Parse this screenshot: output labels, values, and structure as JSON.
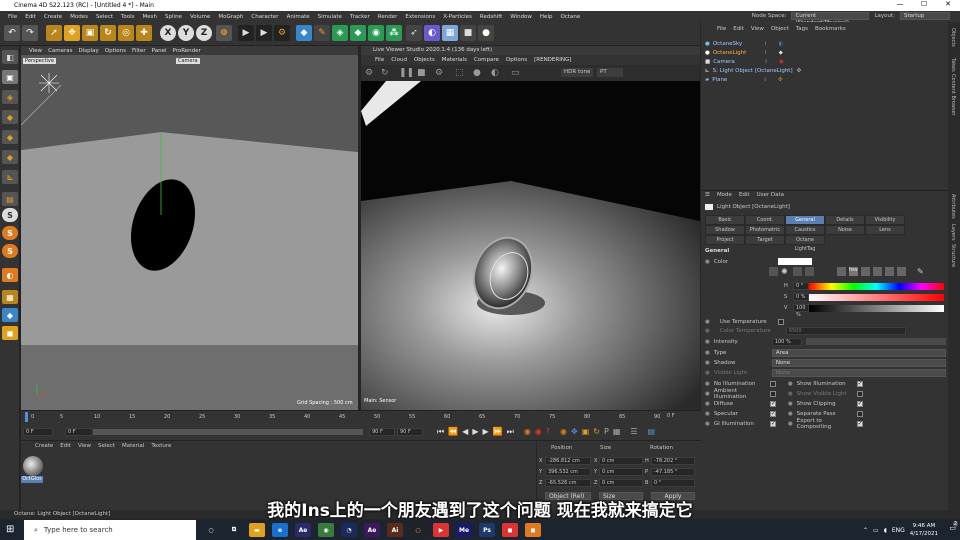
{
  "window": {
    "title": "Cinema 4D S22.123 (RC) - [Untitled 4 *] - Main",
    "min": "—",
    "max": "☐",
    "close": "✕"
  },
  "menu": [
    "File",
    "Edit",
    "Create",
    "Modes",
    "Select",
    "Tools",
    "Mesh",
    "Spline",
    "Volume",
    "MoGraph",
    "Character",
    "Animate",
    "Simulate",
    "Tracker",
    "Render",
    "Extensions",
    "X-Particles",
    "Redshift",
    "Window",
    "Help",
    "Octane"
  ],
  "node_space": {
    "label": "Node Space:",
    "value": "Current (Standard/Physical)",
    "layout_label": "Layout:",
    "layout_value": "Startup"
  },
  "toolbar_letters": [
    "X",
    "Y",
    "Z"
  ],
  "viewport1": {
    "menu": [
      "View",
      "Cameras",
      "Display",
      "Options",
      "Filter",
      "Panel",
      "ProRender"
    ],
    "label": "Perspective",
    "camera": "Camera",
    "grid": "Grid Spacing : 500 cm"
  },
  "viewport2": {
    "title": "Live Viewer Studio 2020.1.4 (136 days left)",
    "menu": [
      "File",
      "Cloud",
      "Objects",
      "Materials",
      "Compare",
      "Options",
      "[RENDERING]"
    ],
    "tone": "HDR tone",
    "pt": "PT",
    "status": "Main: Sensor"
  },
  "om": {
    "menu": [
      "File",
      "Edit",
      "View",
      "Object",
      "Tags",
      "Bookmarks"
    ],
    "items": [
      "OctaneSky",
      "OctaneLight",
      "Camera",
      "S: Light Object [OctaneLight]",
      "Plane"
    ]
  },
  "attr": {
    "menu": [
      "Mode",
      "Edit",
      "User Data"
    ],
    "object": "Light Object [OctaneLight]",
    "tabs": [
      "Basic",
      "Coord.",
      "General",
      "Details",
      "Visibility",
      "Shadow",
      "Photometric",
      "Caustics",
      "Noise",
      "Lens",
      "Project",
      "Target",
      "Octane LightTag"
    ],
    "section": "General",
    "color_label": "Color",
    "h": "H",
    "h_val": "0 °",
    "s": "S",
    "s_val": "0 %",
    "v": "V",
    "v_val": "100 %",
    "use_temp": "Use Temperature",
    "color_temp": "Color Temperature",
    "color_temp_val": "6500",
    "intensity": "Intensity",
    "intensity_val": "100 %",
    "type": "Type",
    "type_val": "Area",
    "shadow": "Shadow",
    "shadow_val": "None",
    "visible": "Visible Light",
    "visible_val": "None",
    "checks_left": [
      "No Illumination",
      "Ambient Illumination",
      "Diffuse",
      "Specular",
      "GI Illumination"
    ],
    "checks_right": [
      "Show Illumination",
      "Show Visible Light",
      "Show Clipping",
      "Separate Pass",
      "Export to Compositing"
    ]
  },
  "timeline": {
    "ticks": [
      "0",
      "5",
      "10",
      "15",
      "20",
      "25",
      "30",
      "35",
      "40",
      "45",
      "50",
      "55",
      "60",
      "65",
      "70",
      "75",
      "80",
      "85",
      "90"
    ],
    "frame": "0 F",
    "start": "0 F",
    "end": "90 F",
    "end2": "90 F",
    "cur": "0 F"
  },
  "matmgr": {
    "menu": [
      "Create",
      "Edit",
      "View",
      "Select",
      "Material",
      "Texture"
    ],
    "mat_name": "OctGlos"
  },
  "coords": {
    "headers": [
      "Position",
      "Size",
      "Rotation"
    ],
    "x": "-286.812 cm",
    "y": "396.532 cm",
    "z": "-65.526 cm",
    "sx": "0 cm",
    "sy": "0 cm",
    "sz": "0 cm",
    "h": "-78.202 °",
    "p": "-47.185 °",
    "b": "0 °",
    "mode": "Object (Rel)",
    "size_mode": "Size",
    "apply": "Apply"
  },
  "status": "Octane:     Light Object [OctaneLight]",
  "subtitle": "我的Ins上的一个朋友遇到了这个问题 现在我就来搞定它",
  "taskbar": {
    "search": "Type here to search",
    "lang": "ENG",
    "time": "9:46 AM",
    "date": "4/17/2021",
    "notify": "2"
  }
}
